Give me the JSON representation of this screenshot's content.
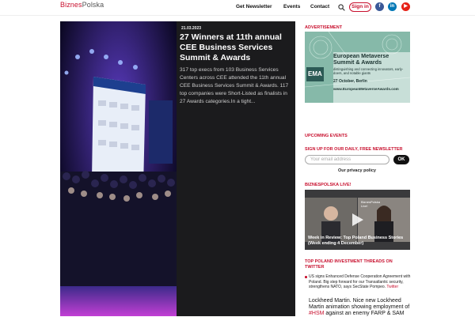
{
  "header": {
    "logo_part1": "Biznes",
    "logo_part2": "Polska",
    "nav": [
      "Get Newsletter",
      "Events",
      "Contact"
    ],
    "signin": "Sign in",
    "social": [
      {
        "name": "facebook",
        "glyph": "f",
        "color": "#3b5998"
      },
      {
        "name": "linkedin",
        "glyph": "in",
        "color": "#0077b5"
      },
      {
        "name": "youtube",
        "glyph": "▶",
        "color": "#e62117"
      }
    ]
  },
  "hero": {
    "date": "21.03.2023",
    "title": "27 Winners at 11th annual CEE Business Services Summit & Awards",
    "text": "317 top execs from 103 Business Services Centers across CEE attended the 11th annual CEE Business Services Summit & Awards. 117 top companies were Short-Listed as finalists in 27 Awards categories.In a tight..."
  },
  "sidebar": {
    "advertisement_heading": "ADVERTISEMENT",
    "ad": {
      "badge": "EMA",
      "title": "European Metaverse Summit & Awards",
      "tagline": "distinguishing and connecting innovators, early-doers, and notable giants",
      "date_place": "27 October, Berlin",
      "url": "www.EuropeanMetaverseAwards.com"
    },
    "upcoming_heading": "UPCOMING EVENTS",
    "newsletter_heading": "SIGN UP FOR OUR DAILY, FREE NEWSLETTER",
    "email_placeholder": "Your email address",
    "ok_label": "OK",
    "privacy_label": "Our privacy policy",
    "live_heading": "BIZNESPOLSKA LIVE!",
    "video": {
      "brand": "BiznesPolska Live!",
      "caption": "Week in Review: Top Poland Business Stories (Week ending 4 December)"
    },
    "twitter_heading": "TOP POLAND INVESTMENT THREADS ON TWITTER",
    "tweet1": {
      "text": "US signs Enhanced Defense Cooperation Agreement with Poland. Big step forward for our Transatlantic security, strengthens NATO, says SecState Pompeo.",
      "link": "Twitter"
    },
    "tweet2": {
      "text1": "Lockheed Martin.  Nice new Lockheed Martin animation showing employment of ",
      "tag": "#HSM",
      "text2": " against an enemy FARP & SAM"
    }
  }
}
